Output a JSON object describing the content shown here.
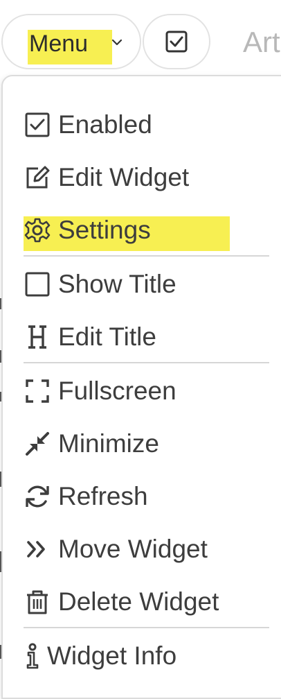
{
  "topbar": {
    "menu_label": "Menu",
    "caret_icon": "chevron-down-icon",
    "check_icon": "checkbox-checked-icon",
    "partial_text": "Art"
  },
  "menu": {
    "items": [
      {
        "label": "Enabled",
        "icon": "checkbox-checked-icon"
      },
      {
        "label": "Edit Widget",
        "icon": "edit-icon"
      },
      {
        "label": "Settings",
        "icon": "gear-icon",
        "highlighted": true
      },
      {
        "label": "Show Title",
        "icon": "checkbox-empty-icon"
      },
      {
        "label": "Edit Title",
        "icon": "heading-icon"
      },
      {
        "label": "Fullscreen",
        "icon": "fullscreen-icon"
      },
      {
        "label": "Minimize",
        "icon": "minimize-icon"
      },
      {
        "label": "Refresh",
        "icon": "refresh-icon"
      },
      {
        "label": "Move Widget",
        "icon": "double-chevron-right-icon"
      },
      {
        "label": "Delete Widget",
        "icon": "trash-icon"
      },
      {
        "label": "Widget Info",
        "icon": "info-icon"
      }
    ]
  },
  "colors": {
    "highlight": "#f7ef52",
    "text": "#3d3d3d",
    "border": "#dcdcdc"
  }
}
